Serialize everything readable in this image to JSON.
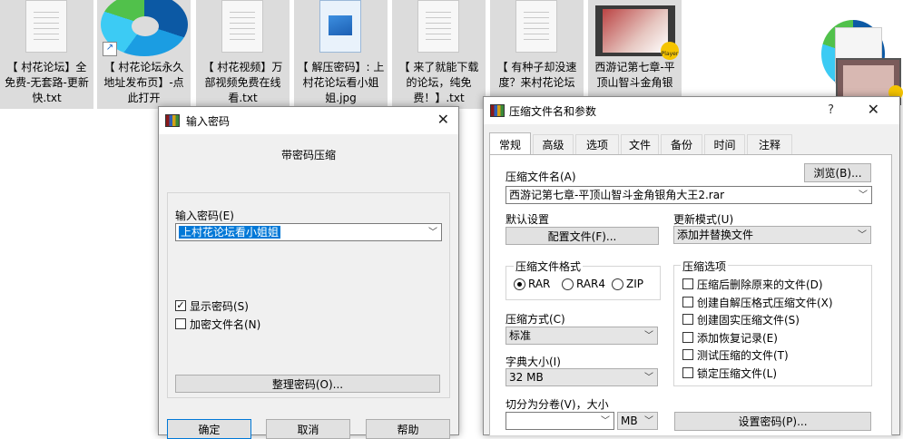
{
  "desktop_files": [
    {
      "label": "【 村花论坛】全免费-无套路-更新快.txt",
      "kind": "doc"
    },
    {
      "label": "【 村花论坛永久地址发布页】-点此打开",
      "kind": "edge"
    },
    {
      "label": "【 村花视频】万部视频免费在线看.txt",
      "kind": "doc"
    },
    {
      "label": "【 解压密码】: 上村花论坛看小姐姐.jpg",
      "kind": "image"
    },
    {
      "label": "【 来了就能下载的论坛，纯免费！】.txt",
      "kind": "doc"
    },
    {
      "label": "【 有种子却没速度？来村花论坛",
      "kind": "doc"
    },
    {
      "label": "西游记第七章-平顶山智斗金角银",
      "kind": "video",
      "badge": "Player"
    }
  ],
  "password_dialog": {
    "title": "输入密码",
    "heading": "带密码压缩",
    "password_label": "输入密码(E)",
    "password_value": "上村花论坛看小姐姐",
    "show_password_label": "显示密码(S)",
    "show_password_checked": true,
    "encrypt_names_label": "加密文件名(N)",
    "encrypt_names_checked": false,
    "organize_button": "整理密码(O)...",
    "ok_button": "确定",
    "cancel_button": "取消",
    "help_button": "帮助"
  },
  "archive_dialog": {
    "title": "压缩文件名和参数",
    "help_glyph": "?",
    "tabs": [
      "常规",
      "高级",
      "选项",
      "文件",
      "备份",
      "时间",
      "注释"
    ],
    "archive_name_label": "压缩文件名(A)",
    "browse_button": "浏览(B)...",
    "archive_name_value": "西游记第七章-平顶山智斗金角银角大王2.rar",
    "default_settings_label": "默认设置",
    "profiles_button": "配置文件(F)...",
    "update_mode_label": "更新模式(U)",
    "update_mode_value": "添加并替换文件",
    "format_label": "压缩文件格式",
    "formats": [
      "RAR",
      "RAR4",
      "ZIP"
    ],
    "selected_format": "RAR",
    "options_label": "压缩选项",
    "options": [
      "压缩后删除原来的文件(D)",
      "创建自解压格式压缩文件(X)",
      "创建固实压缩文件(S)",
      "添加恢复记录(E)",
      "测试压缩的文件(T)",
      "锁定压缩文件(L)"
    ],
    "method_label": "压缩方式(C)",
    "method_value": "标准",
    "dict_label": "字典大小(I)",
    "dict_value": "32 MB",
    "split_label": "切分为分卷(V)，大小",
    "split_value": "",
    "split_unit": "MB",
    "set_password_button": "设置密码(P)..."
  },
  "colors": {
    "selection": "#0078d7",
    "dialog_bg": "#f0f0f0",
    "desktop_tile": "#dcdcdc"
  }
}
